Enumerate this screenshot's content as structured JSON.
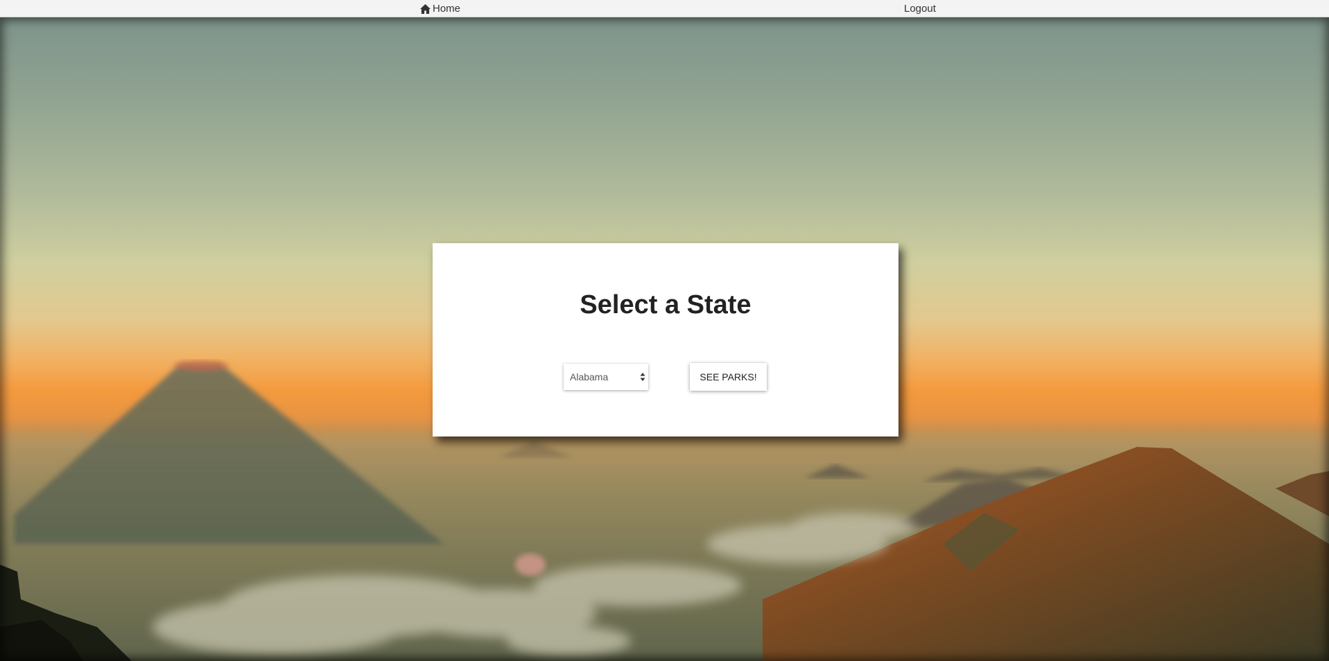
{
  "nav": {
    "home_label": "Home",
    "logout_label": "Logout"
  },
  "card": {
    "title": "Select a State",
    "state_select": {
      "selected": "Alabama"
    },
    "submit_label": "SEE PARKS!"
  },
  "colors": {
    "topbar_bg": "#f3f3f3",
    "card_bg": "#ffffff",
    "text_dark": "#222222"
  }
}
